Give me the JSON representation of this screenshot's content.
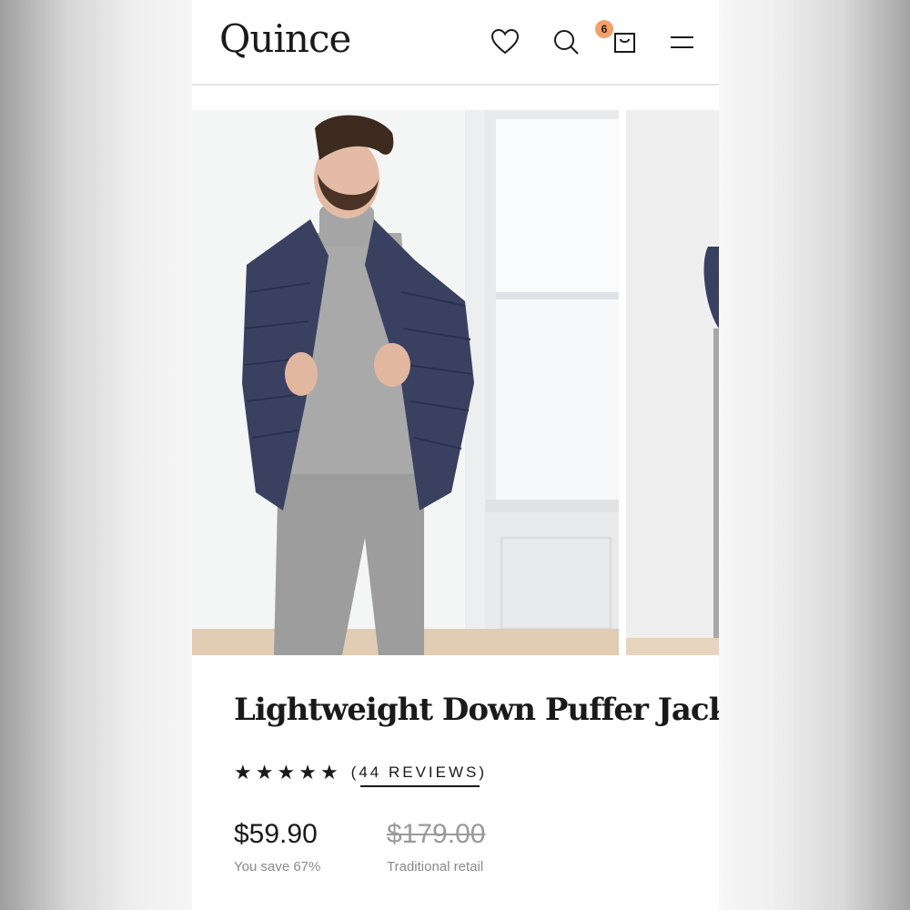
{
  "header": {
    "logo": "Quince",
    "cart_count": "6",
    "icons": [
      "heart-icon",
      "search-icon",
      "bag-icon",
      "menu-icon"
    ]
  },
  "product": {
    "title": "Lightweight Down Puffer Jacket",
    "rating_stars": 5,
    "reviews_label": "(44 REVIEWS)",
    "price": "$59.90",
    "savings": "You save 67%",
    "retail_price": "$179.00",
    "retail_label": "Traditional retail"
  },
  "colors": {
    "accent_badge": "#f2a06a",
    "text": "#1a1a1a",
    "muted": "#8a8a8a",
    "jacket": "#3a4060",
    "sweater": "#a8a8a8"
  }
}
